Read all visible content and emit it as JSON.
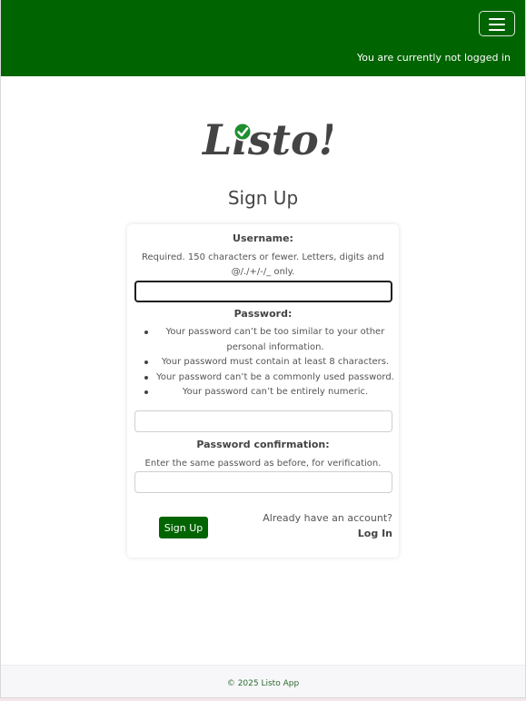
{
  "colors": {
    "brand": "#006400",
    "logo_text": "#444444",
    "logo_badge": "#1e8e2f"
  },
  "navbar": {
    "menu_icon": "hamburger-icon",
    "login_status": "You are currently not logged in"
  },
  "logo": {
    "text": "Listo!",
    "badge_icon": "check-circle-icon"
  },
  "page": {
    "title": "Sign Up"
  },
  "form": {
    "username": {
      "label": "Username:",
      "help": "Required. 150 characters or fewer. Letters, digits and @/./+/-/_ only.",
      "value": ""
    },
    "password": {
      "label": "Password:",
      "rules": [
        "Your password can’t be too similar to your other personal information.",
        "Your password must contain at least 8 characters.",
        "Your password can’t be a commonly used password.",
        "Your password can’t be entirely numeric."
      ],
      "value": ""
    },
    "password_confirmation": {
      "label": "Password confirmation:",
      "help": "Enter the same password as before, for verification.",
      "value": ""
    },
    "submit_label": "Sign Up",
    "account_question": "Already have an account?",
    "login_label": "Log In"
  },
  "footer": {
    "text": "© 2025 Listo App"
  }
}
